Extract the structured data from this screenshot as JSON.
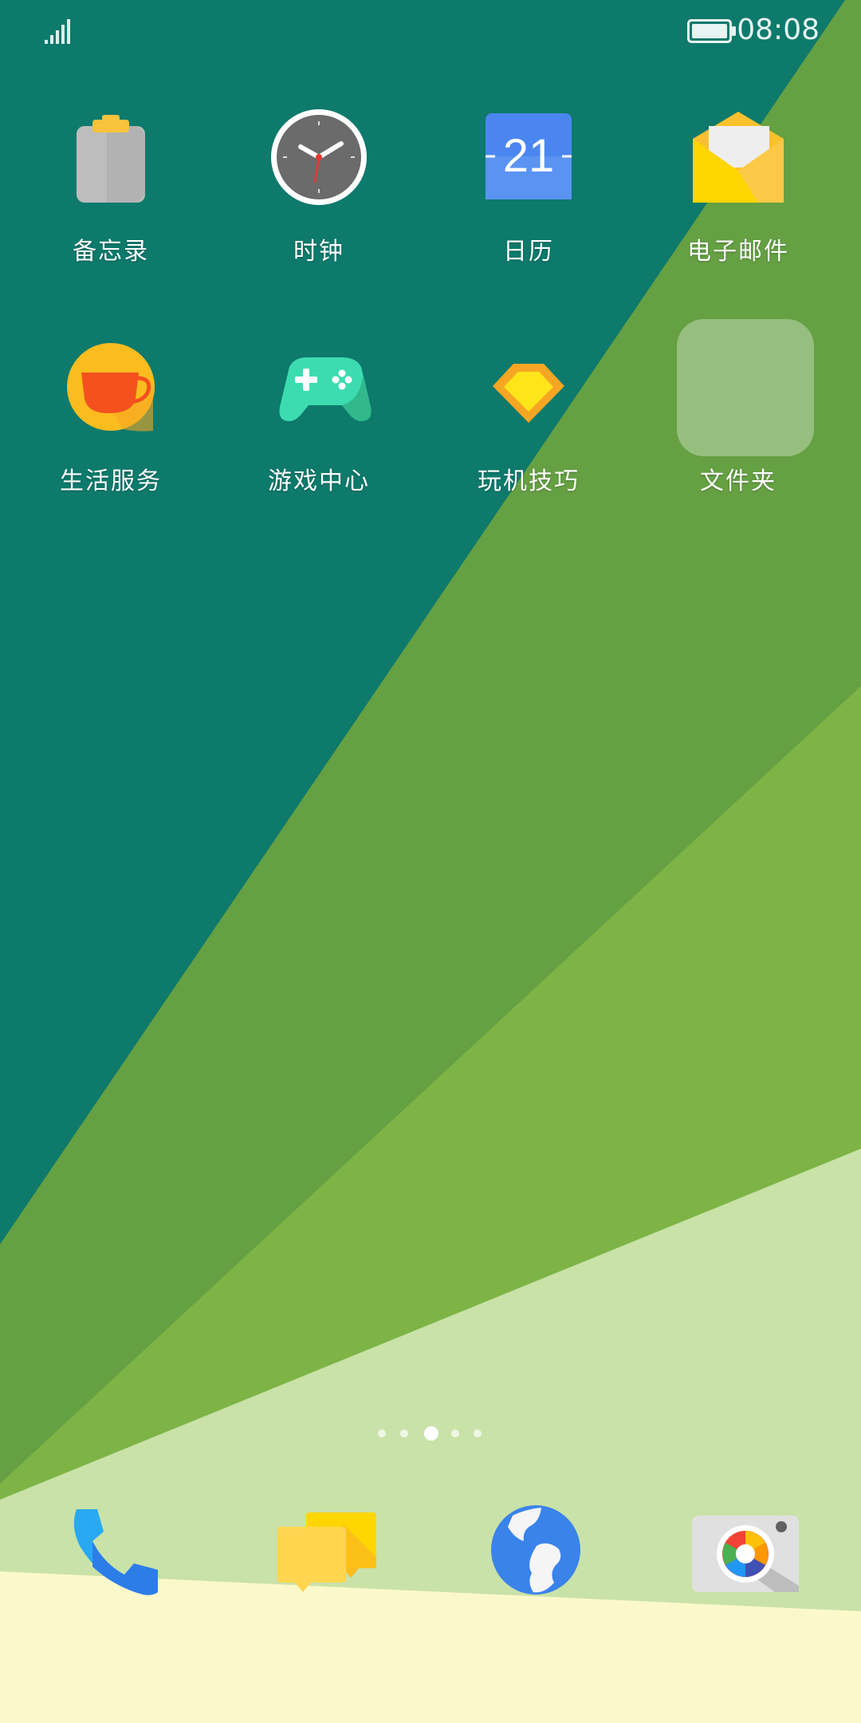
{
  "status_bar": {
    "time": "08:08"
  },
  "apps": [
    {
      "label": "备忘录",
      "icon": "notepad-icon"
    },
    {
      "label": "时钟",
      "icon": "clock-icon"
    },
    {
      "label": "日历",
      "icon": "calendar-icon",
      "day": "21"
    },
    {
      "label": "电子邮件",
      "icon": "email-icon"
    },
    {
      "label": "生活服务",
      "icon": "coffee-cup-icon"
    },
    {
      "label": "游戏中心",
      "icon": "gamepad-icon"
    },
    {
      "label": "玩机技巧",
      "icon": "diamond-icon"
    },
    {
      "label": "文件夹",
      "icon": "folder-icon"
    }
  ],
  "page_indicator": {
    "total": 5,
    "active": 3
  },
  "dock": [
    {
      "icon": "phone-icon"
    },
    {
      "icon": "messages-icon"
    },
    {
      "icon": "browser-icon"
    },
    {
      "icon": "camera-icon"
    }
  ],
  "colors": {
    "wallpaper_teal": "#0d7a6c",
    "wallpaper_green": "#65a043",
    "wallpaper_lime": "#7db445",
    "wallpaper_pale": "#c9e2a8",
    "wallpaper_cream": "#fbf9cc"
  }
}
